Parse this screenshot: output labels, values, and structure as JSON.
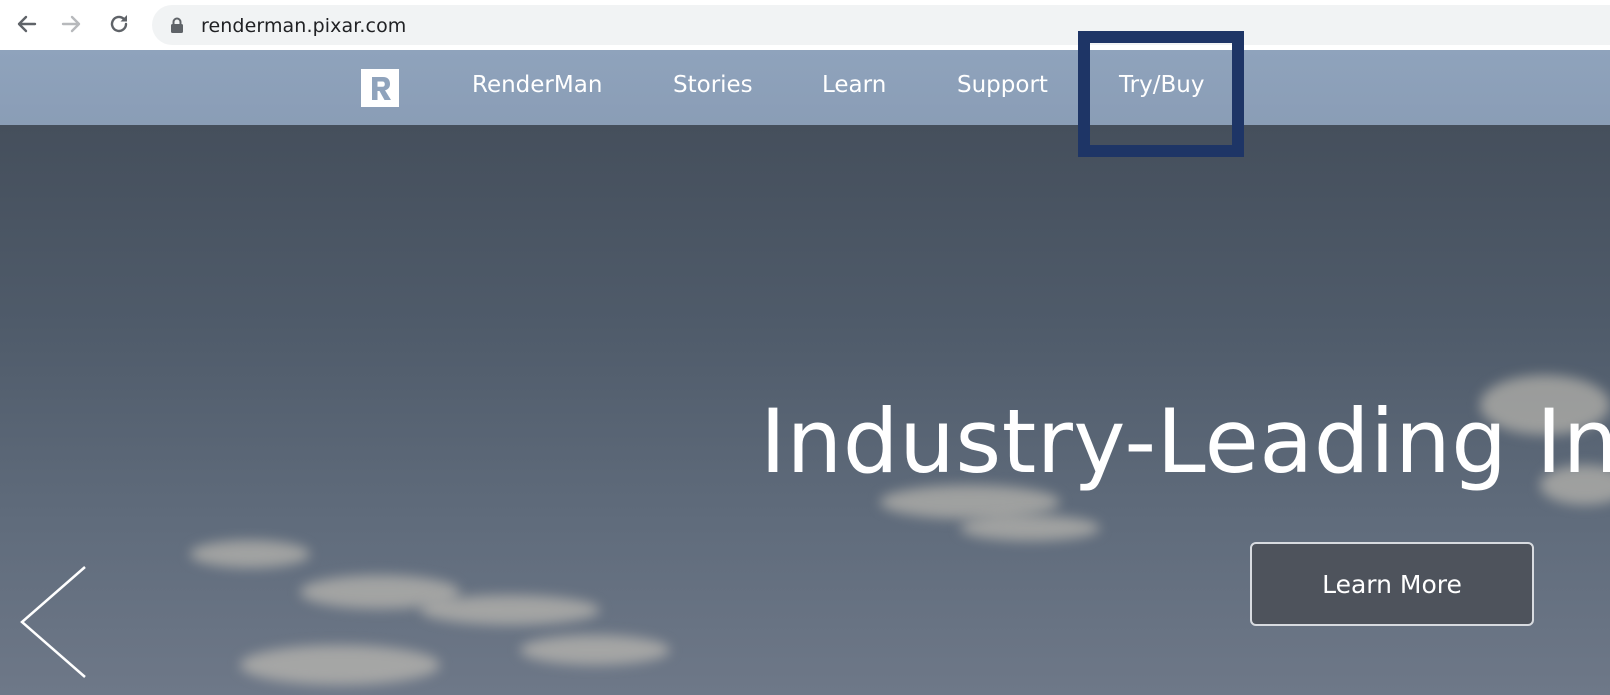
{
  "browser": {
    "url": "renderman.pixar.com",
    "back_icon": "arrow-left-icon",
    "forward_icon": "arrow-right-icon",
    "reload_icon": "reload-icon",
    "lock_icon": "lock-icon"
  },
  "nav": {
    "logo_icon": "renderman-logo-icon",
    "items": [
      {
        "label": "RenderMan"
      },
      {
        "label": "Stories"
      },
      {
        "label": "Learn"
      },
      {
        "label": "Support"
      },
      {
        "label": "Try/Buy"
      }
    ],
    "highlighted_item": "Try/Buy",
    "highlight_color": "#1e3566"
  },
  "hero": {
    "title": "Industry-Leading Inn",
    "cta_label": "Learn More",
    "prev_icon": "chevron-left-icon"
  },
  "colors": {
    "nav_bg": "#8fa3bc",
    "hero_bg": "#4f5b6a",
    "button_bg": "#4e535c"
  }
}
